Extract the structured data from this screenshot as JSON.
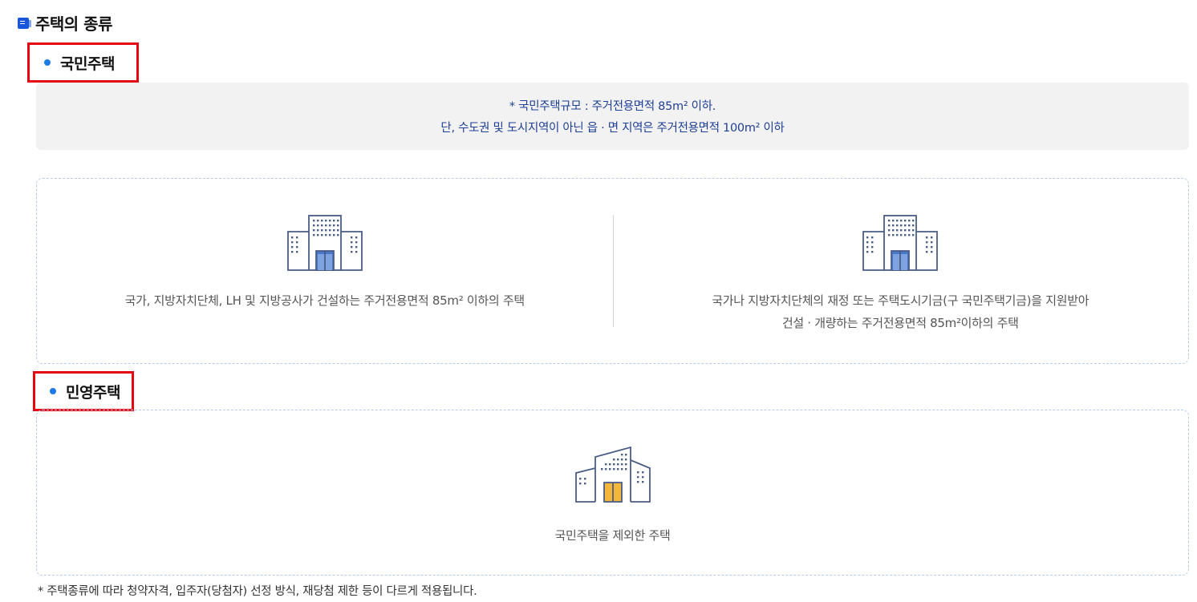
{
  "page_title": "주택의 종류",
  "sections": {
    "national": {
      "heading": "국민주택",
      "note_line1": "* 국민주택규모 : 주거전용면적 85m² 이하.",
      "note_line2": "단, 수도권 및 도시지역이 아닌 읍 · 면 지역은 주거전용면적 100m² 이하",
      "cards": [
        {
          "lines": [
            "국가, 지방자치단체, LH 및 지방공사가 건설하는 주거전용면적 85m² 이하의 주택"
          ]
        },
        {
          "lines": [
            "국가나 지방자치단체의 재정 또는 주택도시기금(구 국민주택기금)을 지원받아",
            "건설 · 개량하는 주거전용면적 85m²이하의 주택"
          ]
        }
      ]
    },
    "private": {
      "heading": "민영주택",
      "card_text": "국민주택을 제외한 주택"
    }
  },
  "footnote": "* 주택종류에 따라 청약자격, 입주자(당첨자) 선정 방식, 재당첨 제한 등이 다르게 적용됩니다.",
  "icons": {
    "title": "document-icon",
    "section_bullet": "bullet-dot-icon",
    "national_building": "apartment-building-icon",
    "private_building": "apartment-building-icon"
  },
  "colors": {
    "accent_blue": "#1e7be6",
    "note_text": "#1f3f94",
    "highlight_border": "#e30613",
    "building_stroke": "#4a5d86",
    "door_blue": "#4a78c8",
    "door_yellow": "#f3b63b"
  }
}
